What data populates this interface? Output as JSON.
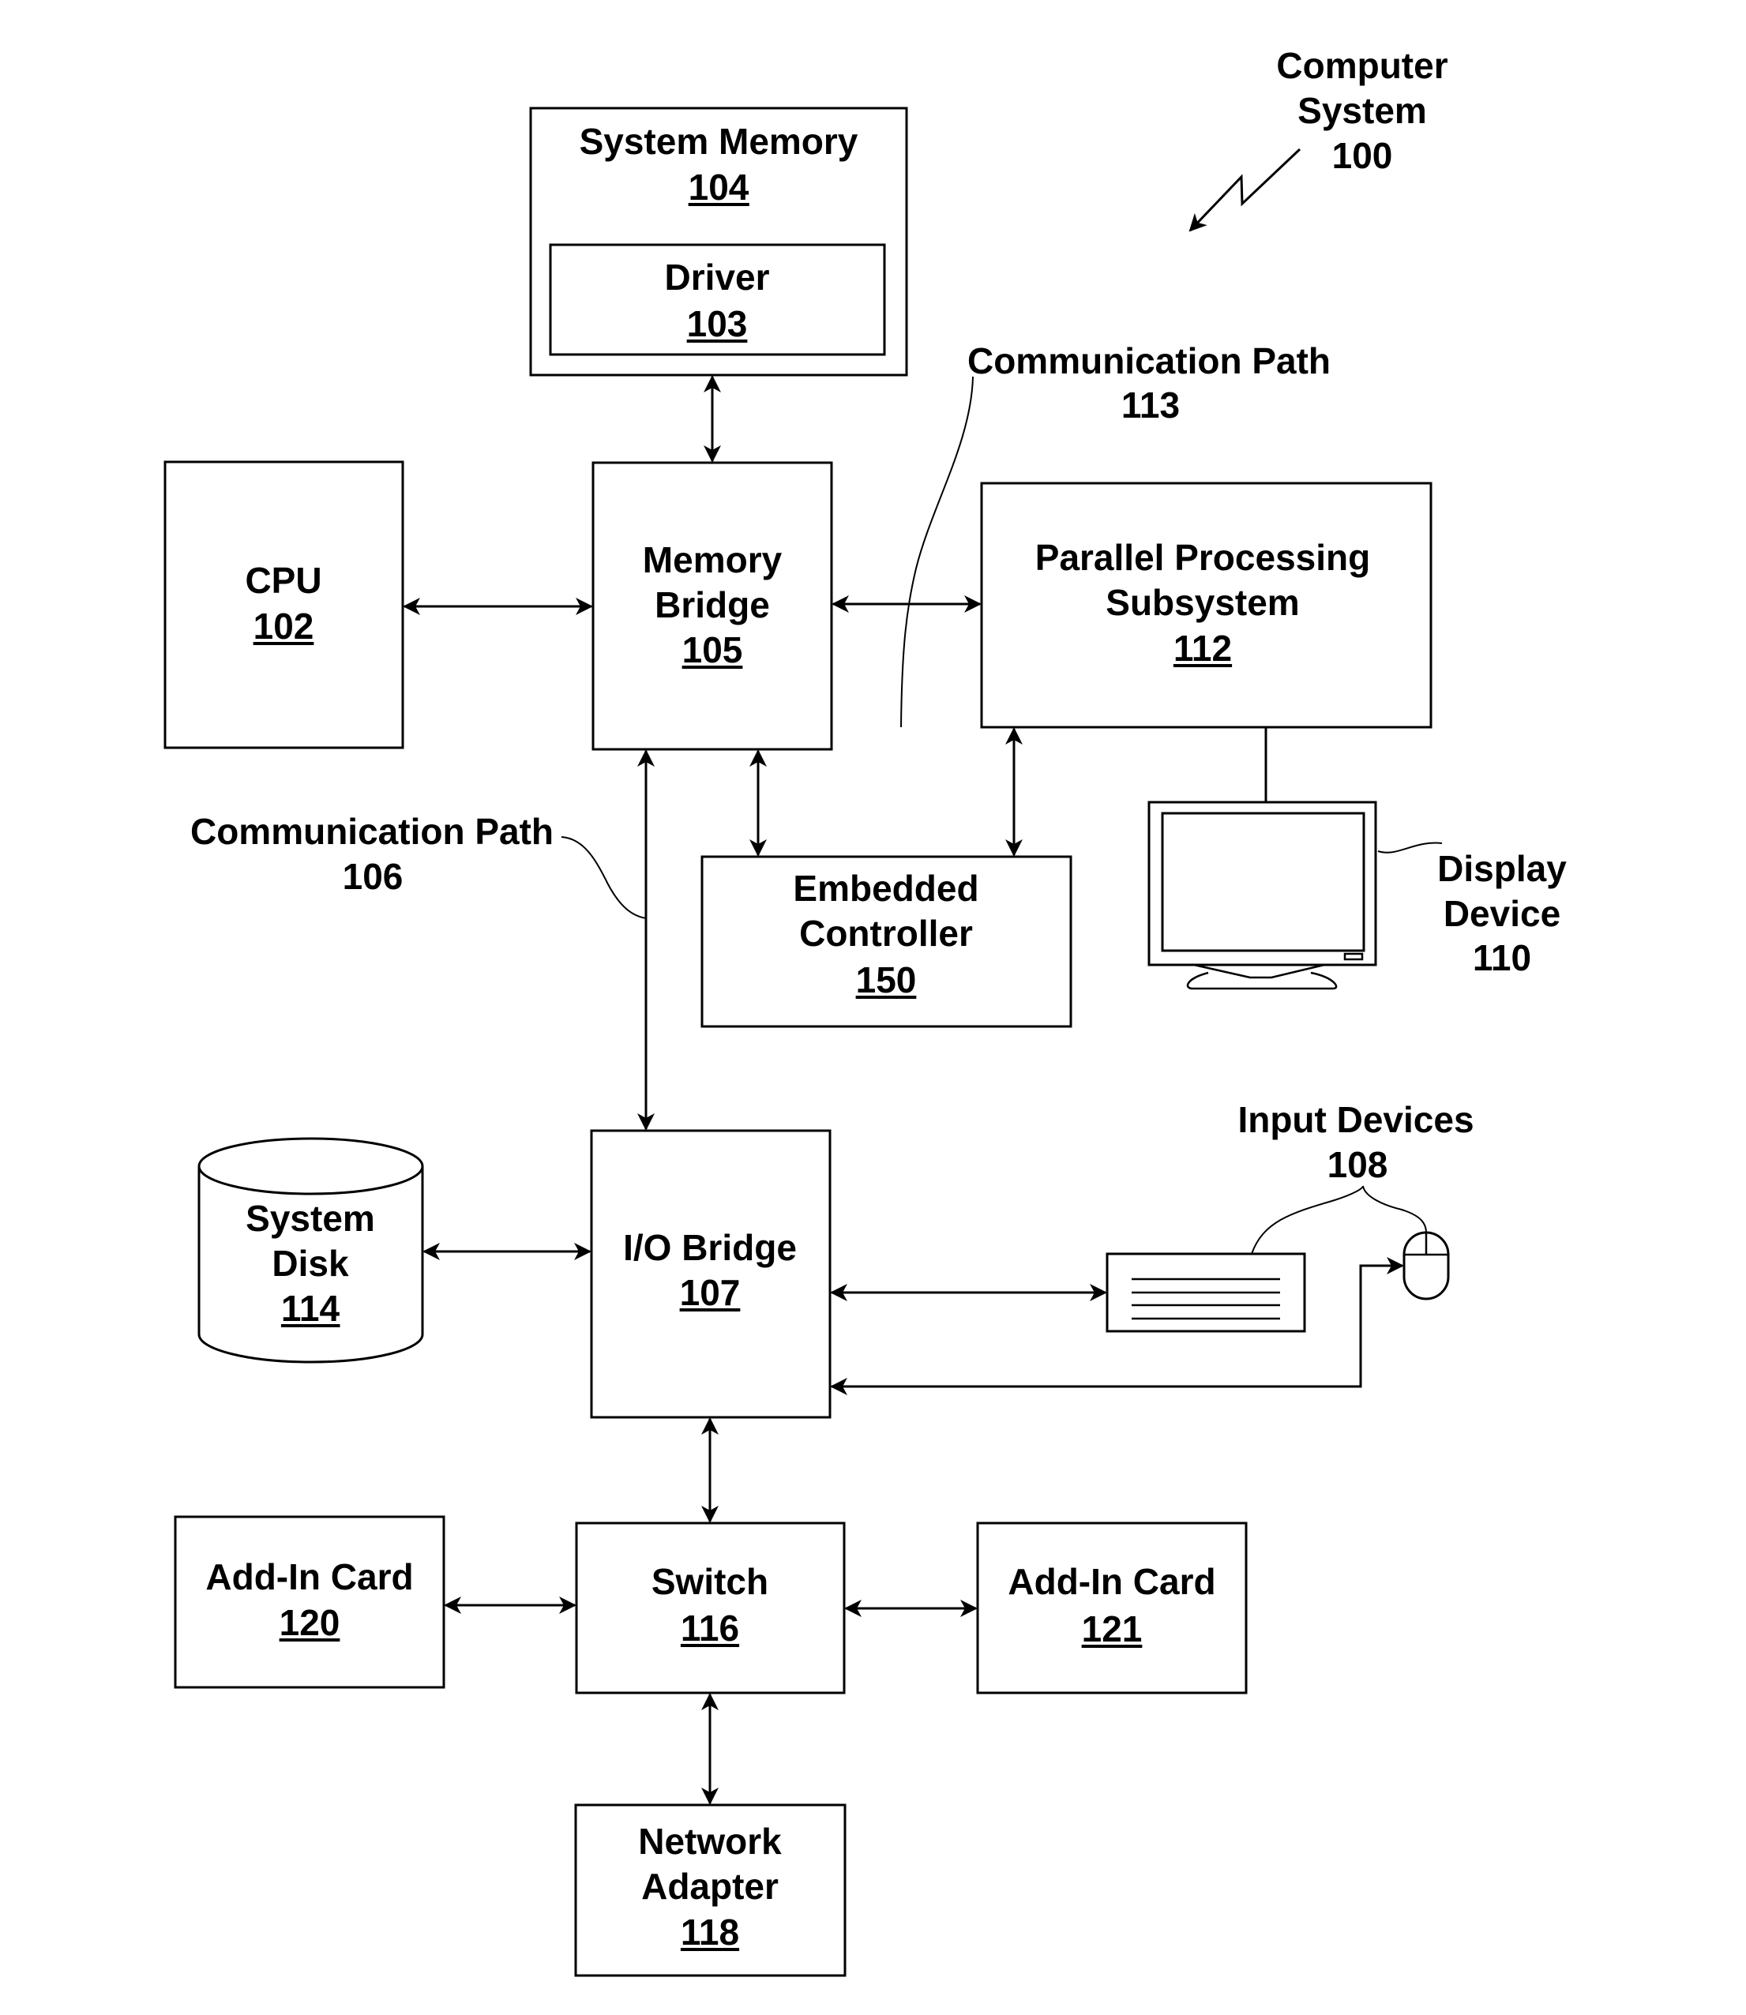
{
  "figure": {
    "title_lines": [
      "Computer",
      "System",
      "100"
    ],
    "colors": {
      "line": "#000000",
      "background": "#ffffff",
      "text": "#000000"
    }
  },
  "blocks": {
    "system_memory": {
      "label": "System Memory",
      "ref": "104"
    },
    "driver": {
      "label": "Driver",
      "ref": "103"
    },
    "cpu": {
      "label": "CPU",
      "ref": "102"
    },
    "memory_bridge": {
      "label_lines": [
        "Memory",
        "Bridge"
      ],
      "ref": "105"
    },
    "parallel_processing": {
      "label_lines": [
        "Parallel Processing",
        "Subsystem"
      ],
      "ref": "112"
    },
    "embedded_controller": {
      "label_lines": [
        "Embedded",
        "Controller"
      ],
      "ref": "150"
    },
    "io_bridge": {
      "label": "I/O Bridge",
      "ref": "107"
    },
    "system_disk": {
      "label_lines": [
        "System",
        "Disk"
      ],
      "ref": "114"
    },
    "switch": {
      "label": "Switch",
      "ref": "116"
    },
    "add_in_card_120": {
      "label": "Add-In Card",
      "ref": "120"
    },
    "add_in_card_121": {
      "label": "Add-In Card",
      "ref": "121"
    },
    "network_adapter": {
      "label_lines": [
        "Network",
        "Adapter"
      ],
      "ref": "118"
    }
  },
  "callouts": {
    "comm_path_113": {
      "label": "Communication Path",
      "ref": "113"
    },
    "comm_path_106": {
      "label": "Communication Path",
      "ref": "106"
    },
    "display_device": {
      "label_lines": [
        "Display",
        "Device"
      ],
      "ref": "110"
    },
    "input_devices": {
      "label": "Input Devices",
      "ref": "108"
    }
  },
  "icons": {
    "display": "monitor-icon",
    "keyboard": "keyboard-icon",
    "mouse": "mouse-icon",
    "disk": "cylinder-disk-icon",
    "reference_arrow": "lightning-arrow-icon"
  }
}
